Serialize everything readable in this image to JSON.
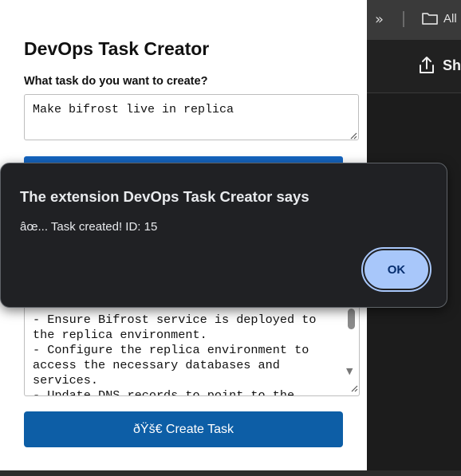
{
  "browser": {
    "toolbar": {
      "overflow_glyph": "»",
      "bookmarks_label": "All",
      "share_label": "Sha"
    }
  },
  "popup": {
    "title": "DevOps Task Creator",
    "prompt_label": "What task do you want to create?",
    "task_input_value": "Make bifrost live in replica",
    "output_text": "- Ensure Bifrost service is deployed to the replica environment.\n- Configure the replica environment to access the necessary databases and services.\n- Update DNS records to point to the",
    "create_button_label": "ðŸš€ Create Task"
  },
  "dialog": {
    "title": "The extension DevOps Task Creator says",
    "message": "âœ... Task created! ID: 15",
    "ok_label": "OK"
  },
  "colors": {
    "primary_button": "#0d5ea6",
    "dialog_bg": "#202124",
    "ok_button": "#a8c7fa"
  }
}
